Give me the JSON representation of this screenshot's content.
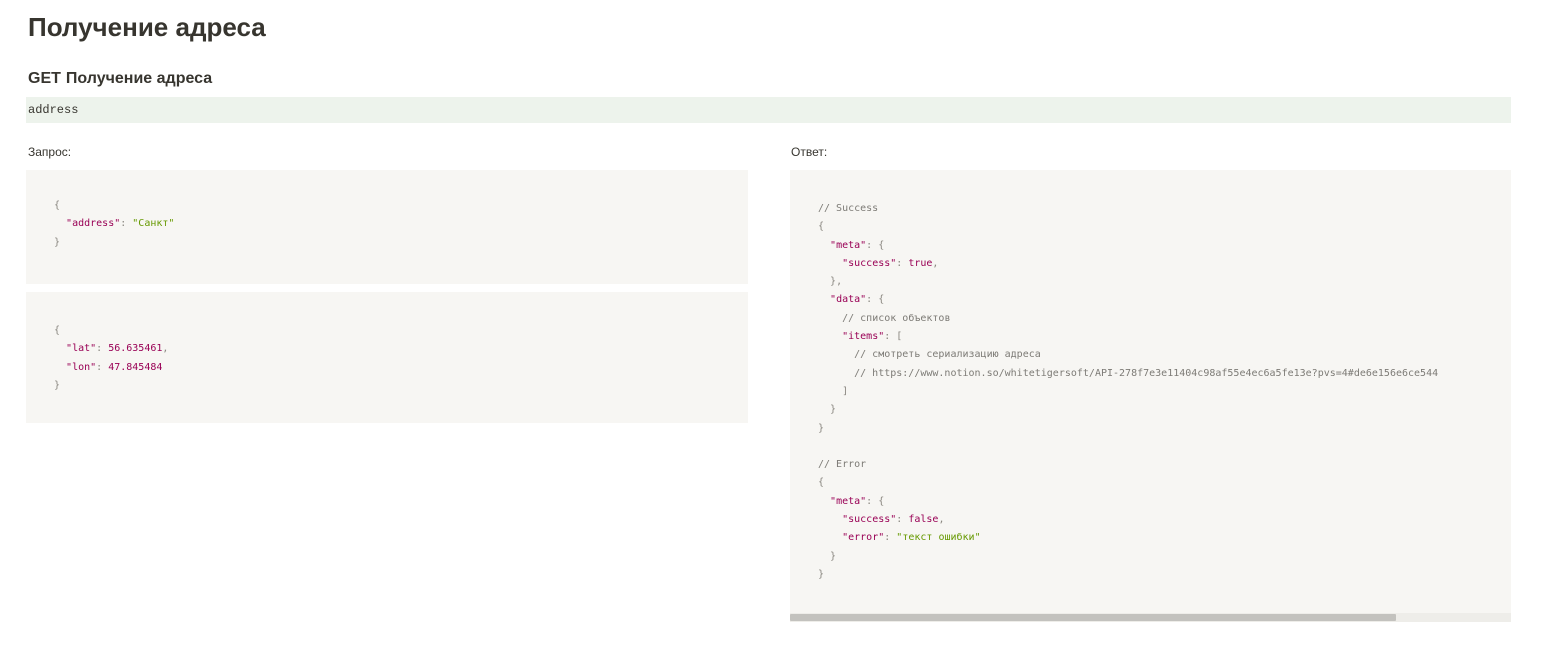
{
  "page": {
    "title": "Получение адреса"
  },
  "endpoint": {
    "method": "GET",
    "name": "Получение адреса",
    "path": "address"
  },
  "request": {
    "label": "Запрос:",
    "examples": [
      {
        "lines": [
          [
            {
              "t": "punct",
              "v": "{"
            }
          ],
          [
            {
              "t": "text",
              "v": "  "
            },
            {
              "t": "key",
              "v": "\"address\""
            },
            {
              "t": "punct",
              "v": ": "
            },
            {
              "t": "str",
              "v": "\"Санкт\""
            }
          ],
          [
            {
              "t": "punct",
              "v": "}"
            }
          ]
        ]
      },
      {
        "lines": [
          [
            {
              "t": "punct",
              "v": "{"
            }
          ],
          [
            {
              "t": "text",
              "v": "  "
            },
            {
              "t": "key",
              "v": "\"lat\""
            },
            {
              "t": "punct",
              "v": ": "
            },
            {
              "t": "num",
              "v": "56.635461"
            },
            {
              "t": "punct",
              "v": ","
            }
          ],
          [
            {
              "t": "text",
              "v": "  "
            },
            {
              "t": "key",
              "v": "\"lon\""
            },
            {
              "t": "punct",
              "v": ": "
            },
            {
              "t": "num",
              "v": "47.845484"
            }
          ],
          [
            {
              "t": "punct",
              "v": "}"
            }
          ]
        ]
      }
    ]
  },
  "response": {
    "label": "Ответ:",
    "scroll_fraction_visible": 0.84,
    "lines": [
      [
        {
          "t": "comment",
          "v": "// Success"
        }
      ],
      [
        {
          "t": "punct",
          "v": "{"
        }
      ],
      [
        {
          "t": "text",
          "v": "  "
        },
        {
          "t": "key",
          "v": "\"meta\""
        },
        {
          "t": "punct",
          "v": ": {"
        }
      ],
      [
        {
          "t": "text",
          "v": "    "
        },
        {
          "t": "key",
          "v": "\"success\""
        },
        {
          "t": "punct",
          "v": ": "
        },
        {
          "t": "bool",
          "v": "true"
        },
        {
          "t": "punct",
          "v": ","
        }
      ],
      [
        {
          "t": "text",
          "v": "  "
        },
        {
          "t": "punct",
          "v": "},"
        }
      ],
      [
        {
          "t": "text",
          "v": "  "
        },
        {
          "t": "key",
          "v": "\"data\""
        },
        {
          "t": "punct",
          "v": ": {"
        }
      ],
      [
        {
          "t": "text",
          "v": "    "
        },
        {
          "t": "comment",
          "v": "// список объектов"
        }
      ],
      [
        {
          "t": "text",
          "v": "    "
        },
        {
          "t": "key",
          "v": "\"items\""
        },
        {
          "t": "punct",
          "v": ": ["
        }
      ],
      [
        {
          "t": "text",
          "v": "      "
        },
        {
          "t": "comment",
          "v": "// смотреть сериализацию адреса"
        }
      ],
      [
        {
          "t": "text",
          "v": "      "
        },
        {
          "t": "comment",
          "v": "// https://www.notion.so/whitetigersoft/API-278f7e3e11404c98af55e4ec6a5fe13e?pvs=4#de6e156e6ce544"
        }
      ],
      [
        {
          "t": "text",
          "v": "    "
        },
        {
          "t": "punct",
          "v": "]"
        }
      ],
      [
        {
          "t": "text",
          "v": "  "
        },
        {
          "t": "punct",
          "v": "}"
        }
      ],
      [
        {
          "t": "punct",
          "v": "}"
        }
      ],
      [],
      [
        {
          "t": "comment",
          "v": "// Error"
        }
      ],
      [
        {
          "t": "punct",
          "v": "{"
        }
      ],
      [
        {
          "t": "text",
          "v": "  "
        },
        {
          "t": "key",
          "v": "\"meta\""
        },
        {
          "t": "punct",
          "v": ": {"
        }
      ],
      [
        {
          "t": "text",
          "v": "    "
        },
        {
          "t": "key",
          "v": "\"success\""
        },
        {
          "t": "punct",
          "v": ": "
        },
        {
          "t": "bool",
          "v": "false"
        },
        {
          "t": "punct",
          "v": ","
        }
      ],
      [
        {
          "t": "text",
          "v": "    "
        },
        {
          "t": "key",
          "v": "\"error\""
        },
        {
          "t": "punct",
          "v": ": "
        },
        {
          "t": "str",
          "v": "\"текст ошибки\""
        }
      ],
      [
        {
          "t": "text",
          "v": "  "
        },
        {
          "t": "punct",
          "v": "}"
        }
      ],
      [
        {
          "t": "punct",
          "v": "}"
        }
      ]
    ]
  }
}
